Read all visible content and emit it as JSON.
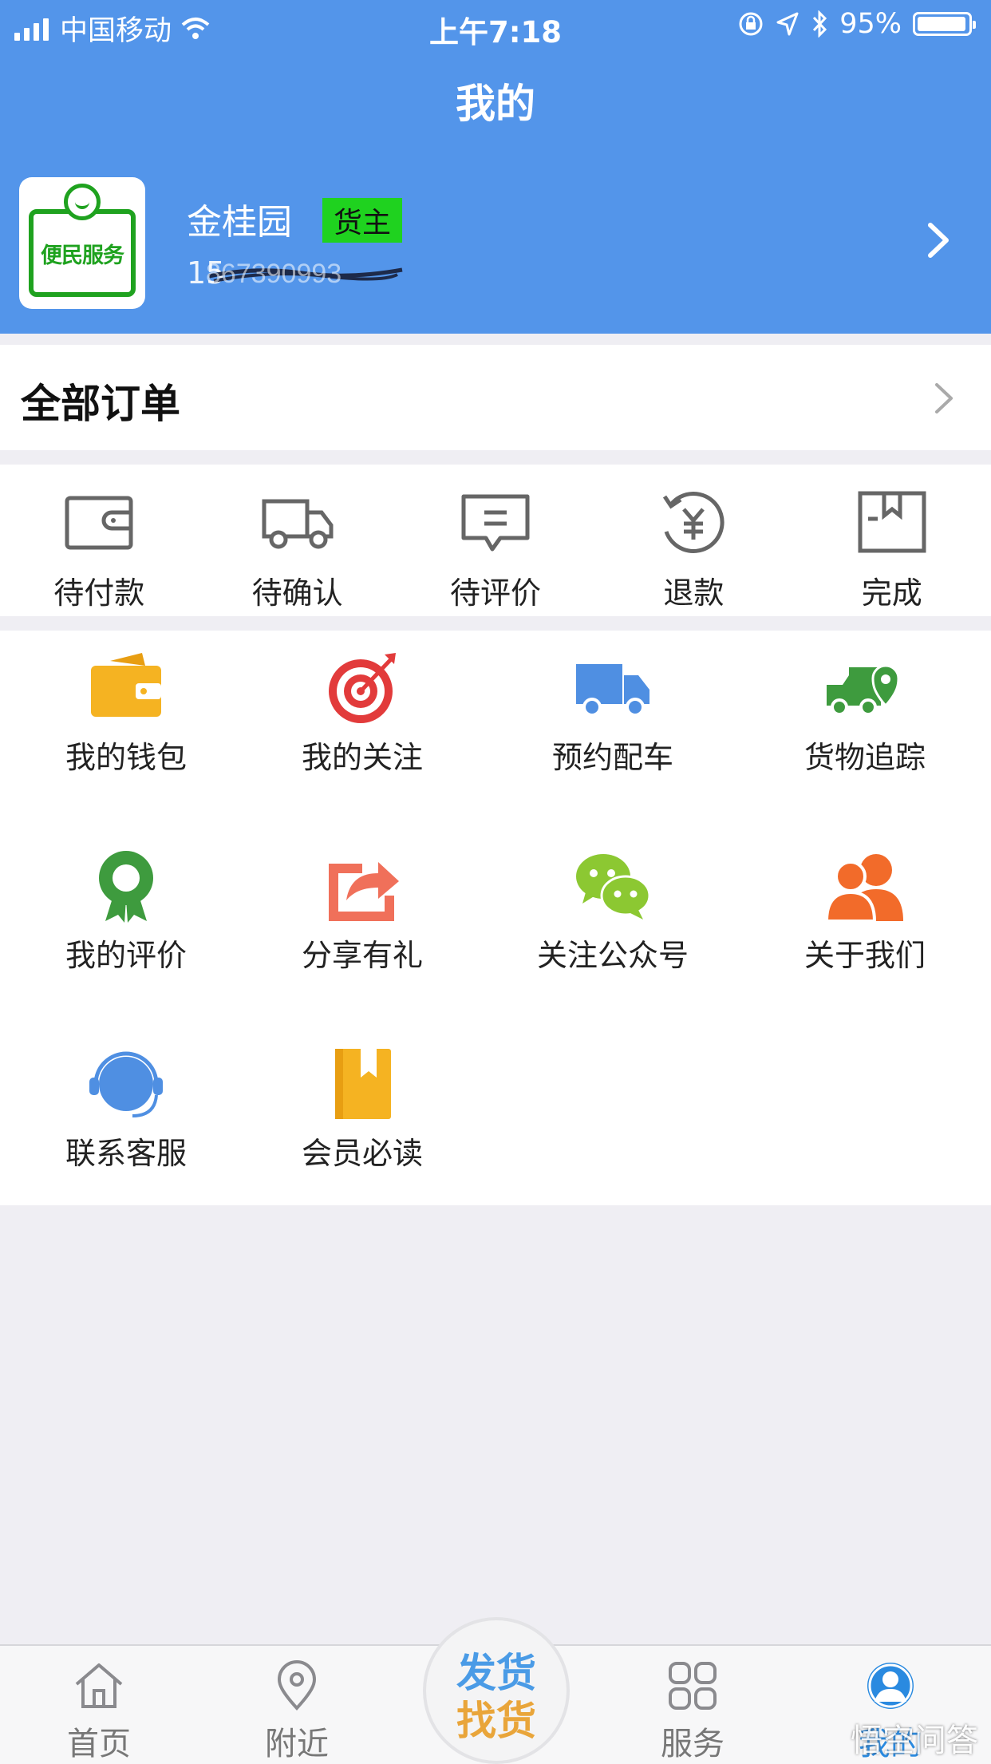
{
  "status_bar": {
    "carrier": "中国移动",
    "time": "上午7:18",
    "battery": "95%"
  },
  "header": {
    "title": "我的"
  },
  "profile": {
    "name": "金桂园",
    "role_badge": "货主",
    "phone": "15",
    "avatar_text": "便民服务"
  },
  "orders": {
    "all_orders_label": "全部订单",
    "statuses": [
      {
        "label": "待付款",
        "icon": "wallet-outline-icon"
      },
      {
        "label": "待确认",
        "icon": "truck-outline-icon"
      },
      {
        "label": "待评价",
        "icon": "chat-outline-icon"
      },
      {
        "label": "退款",
        "icon": "refund-yuan-icon"
      },
      {
        "label": "完成",
        "icon": "box-outline-icon"
      }
    ]
  },
  "services": [
    {
      "label": "我的钱包",
      "icon": "wallet-icon",
      "color": "#f5b322"
    },
    {
      "label": "我的关注",
      "icon": "target-icon",
      "color": "#e23b3b"
    },
    {
      "label": "预约配车",
      "icon": "truck-icon",
      "color": "#4f8fe2"
    },
    {
      "label": "货物追踪",
      "icon": "truck-location-icon",
      "color": "#3e9b3e"
    },
    {
      "label": "我的评价",
      "icon": "award-icon",
      "color": "#3e9b3e"
    },
    {
      "label": "分享有礼",
      "icon": "share-icon",
      "color": "#f0705a"
    },
    {
      "label": "关注公众号",
      "icon": "wechat-icon",
      "color": "#8cc832"
    },
    {
      "label": "关于我们",
      "icon": "people-icon",
      "color": "#f26b2a"
    },
    {
      "label": "联系客服",
      "icon": "headset-icon",
      "color": "#4f8fe2"
    },
    {
      "label": "会员必读",
      "icon": "book-icon",
      "color": "#f5b322"
    }
  ],
  "tabbar": {
    "tabs": [
      {
        "label": "首页",
        "icon": "home-icon"
      },
      {
        "label": "附近",
        "icon": "location-icon"
      },
      {
        "label": "服务",
        "icon": "grid-icon"
      },
      {
        "label": "我的",
        "icon": "user-circle-icon",
        "active": true
      }
    ],
    "center_line1": "发货",
    "center_line2": "找货"
  },
  "watermark": "悟空问答",
  "colors": {
    "header_bg": "#5395ea",
    "active_tab": "#2a8ae0",
    "badge_bg": "#1fd21f"
  }
}
